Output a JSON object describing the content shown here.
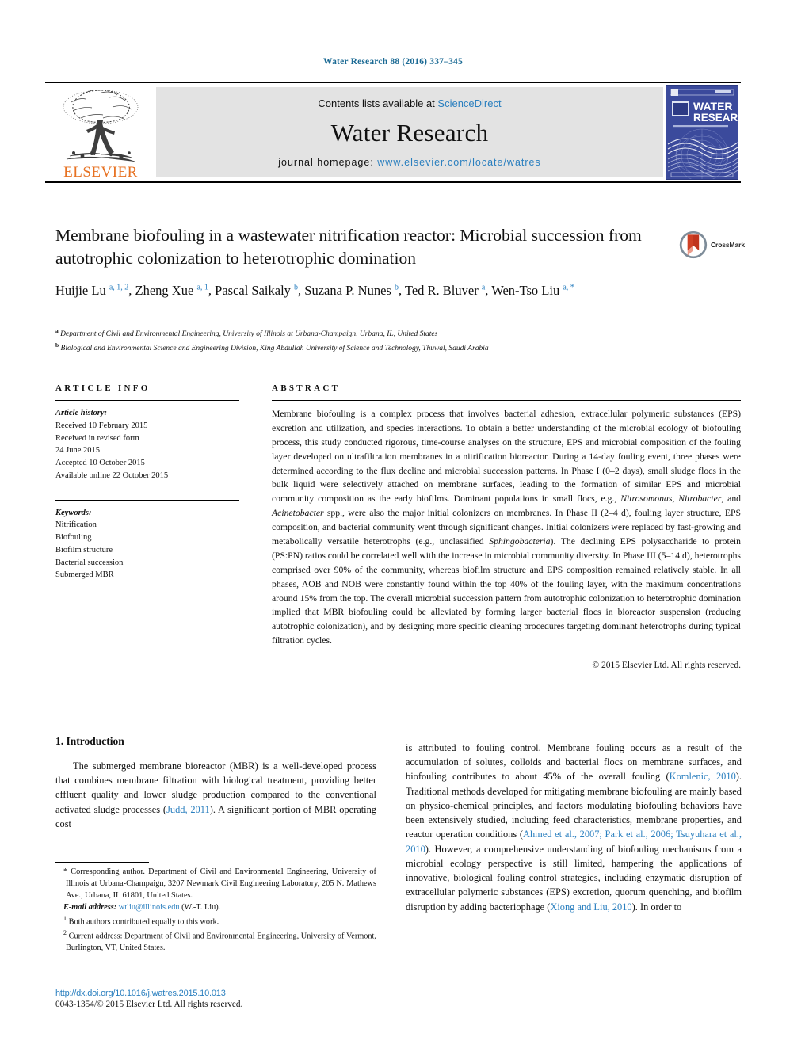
{
  "running_head": "Water Research 88 (2016) 337–345",
  "masthead": {
    "publisher": "ELSEVIER",
    "contents_prefix": "Contents lists available at ",
    "contents_link": "ScienceDirect",
    "journal_name": "Water Research",
    "homepage_prefix": "journal homepage: ",
    "homepage_url": "www.elsevier.com/locate/watres",
    "cover_title_line1": "WATER",
    "cover_title_line2": "RESEARCH"
  },
  "article": {
    "title": "Membrane biofouling in a wastewater nitrification reactor: Microbial succession from autotrophic colonization to heterotrophic domination",
    "crossmark_label": "CrossMark",
    "authors_html": "Huijie Lu <sup>a, 1, 2</sup>, Zheng Xue <sup>a, 1</sup>, Pascal Saikaly <sup>b</sup>, Suzana P. Nunes <sup>b</sup>, Ted R. Bluver <sup>a</sup>, Wen-Tso Liu <sup>a, *</sup>",
    "affiliation_a": "Department of Civil and Environmental Engineering, University of Illinois at Urbana-Champaign, Urbana, IL, United States",
    "affiliation_b": "Biological and Environmental Science and Engineering Division, King Abdullah University of Science and Technology, Thuwal, Saudi Arabia"
  },
  "article_info": {
    "heading": "ARTICLE INFO",
    "history_label": "Article history:",
    "history": [
      "Received 10 February 2015",
      "Received in revised form",
      "24 June 2015",
      "Accepted 10 October 2015",
      "Available online 22 October 2015"
    ],
    "keywords_label": "Keywords:",
    "keywords": [
      "Nitrification",
      "Biofouling",
      "Biofilm structure",
      "Bacterial succession",
      "Submerged MBR"
    ]
  },
  "abstract": {
    "heading": "ABSTRACT",
    "paragraph_html": "Membrane biofouling is a complex process that involves bacterial adhesion, extracellular polymeric substances (EPS) excretion and utilization, and species interactions. To obtain a better understanding of the microbial ecology of biofouling process, this study conducted rigorous, time-course analyses on the structure, EPS and microbial composition of the fouling layer developed on ultrafiltration membranes in a nitrification bioreactor. During a 14-day fouling event, three phases were determined according to the flux decline and microbial succession patterns. In Phase I (0–2 days), small sludge flocs in the bulk liquid were selectively attached on membrane surfaces, leading to the formation of similar EPS and microbial community composition as the early biofilms. Dominant populations in small flocs, e.g., <i>Nitrosomonas</i>, <i>Nitrobacter</i>, and <i>Acinetobacter</i> spp., were also the major initial colonizers on membranes. In Phase II (2–4 d), fouling layer structure, EPS composition, and bacterial community went through significant changes. Initial colonizers were replaced by fast-growing and metabolically versatile heterotrophs (e.g., unclassified <i>Sphingobacteria</i>). The declining EPS polysaccharide to protein (PS:PN) ratios could be correlated well with the increase in microbial community diversity. In Phase III (5–14 d), heterotrophs comprised over 90% of the community, whereas biofilm structure and EPS composition remained relatively stable. In all phases, AOB and NOB were constantly found within the top 40% of the fouling layer, with the maximum concentrations around 15% from the top. The overall microbial succession pattern from autotrophic colonization to heterotrophic domination implied that MBR biofouling could be alleviated by forming larger bacterial flocs in bioreactor suspension (reducing autotrophic colonization), and by designing more specific cleaning procedures targeting dominant heterotrophs during typical filtration cycles.",
    "copyright": "© 2015 Elsevier Ltd. All rights reserved."
  },
  "body": {
    "intro_heading": "1. Introduction",
    "left_paragraph_html": "The submerged membrane bioreactor (MBR) is a well-developed process that combines membrane filtration with biological treatment, providing better effluent quality and lower sludge production compared to the conventional activated sludge processes (<span class=\"cit\">Judd, 2011</span>). A significant portion of MBR operating cost",
    "right_paragraph_html": "is attributed to fouling control. Membrane fouling occurs as a result of the accumulation of solutes, colloids and bacterial flocs on membrane surfaces, and biofouling contributes to about 45% of the overall fouling (<span class=\"cit\">Komlenic, 2010</span>). Traditional methods developed for mitigating membrane biofouling are mainly based on physico-chemical principles, and factors modulating biofouling behaviors have been extensively studied, including feed characteristics, membrane properties, and reactor operation conditions (<span class=\"cit\">Ahmed et al., 2007; Park et al., 2006; Tsuyuhara et al., 2010</span>). However, a comprehensive understanding of biofouling mechanisms from a microbial ecology perspective is still limited, hampering the applications of innovative, biological fouling control strategies, including enzymatic disruption of extracellular polymeric substances (EPS) excretion, quorum quenching, and biofilm disruption by adding bacteriophage (<span class=\"cit\">Xiong and Liu, 2010</span>). In order to"
  },
  "footnotes": {
    "corresponding_html": "* Corresponding author. Department of Civil and Environmental Engineering, University of Illinois at Urbana-Champaign, 3207 Newmark Civil Engineering Laboratory, 205 N. Mathews Ave., Urbana, IL 61801, United States.",
    "email_html": "<span class=\"em\">E-mail address:</span> <span class=\"link\">wtliu@illinois.edu</span> (W.-T. Liu).",
    "note1_html": "<sup>1</sup> Both authors contributed equally to this work.",
    "note2_html": "<sup>2</sup> Current address: Department of Civil and Environmental Engineering, University of Vermont, Burlington, VT, United States."
  },
  "doi": {
    "url": "http://dx.doi.org/10.1016/j.watres.2015.10.013",
    "issn_line": "0043-1354/© 2015 Elsevier Ltd. All rights reserved."
  },
  "colors": {
    "link_blue": "#2a7fbf",
    "running_head_blue": "#1b6a94",
    "elsevier_orange": "#E77121",
    "cover_blue": "#3b4a9c",
    "masthead_grey": "#e3e3e3"
  }
}
